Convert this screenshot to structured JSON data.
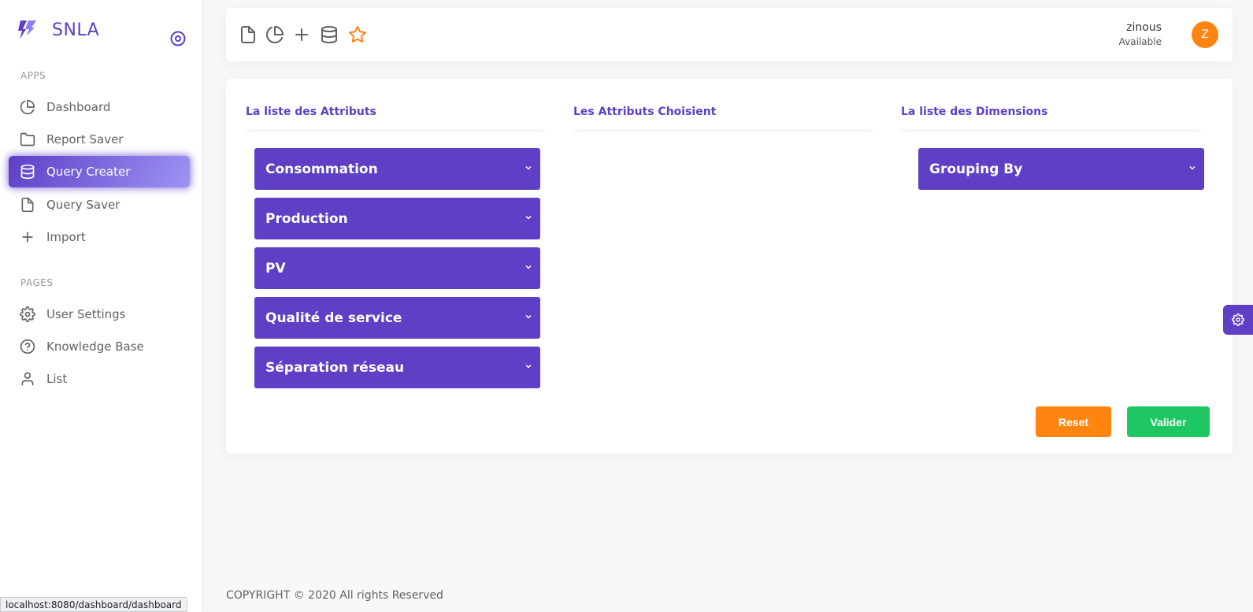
{
  "brand": {
    "name": "SNLA",
    "color": "#5e3fc6"
  },
  "sidebar": {
    "sections": [
      "APPS",
      "PAGES"
    ],
    "apps": [
      {
        "label": "Dashboard",
        "icon": "pie-chart-icon"
      },
      {
        "label": "Report Saver",
        "icon": "folder-icon"
      },
      {
        "label": "Query Creater",
        "icon": "database-icon",
        "active": true
      },
      {
        "label": "Query Saver",
        "icon": "file-icon"
      },
      {
        "label": "Import",
        "icon": "plus-icon"
      }
    ],
    "pages": [
      {
        "label": "User Settings",
        "icon": "gear-icon"
      },
      {
        "label": "Knowledge Base",
        "icon": "help-circle-icon"
      },
      {
        "label": "List",
        "icon": "user-icon"
      }
    ]
  },
  "topbar": {
    "icons": [
      "file-icon",
      "pie-chart-icon",
      "plus-icon",
      "database-icon",
      "star-icon"
    ],
    "user": {
      "name": "zinous",
      "status": "Available",
      "initial": "Z"
    }
  },
  "main": {
    "columns": [
      {
        "title": "La liste des Attributs"
      },
      {
        "title": "Les Attributs Choisient"
      },
      {
        "title": "La liste des Dimensions"
      }
    ],
    "attributes": [
      "Consommation",
      "Production",
      "PV",
      "Qualité de service",
      "Séparation réseau"
    ],
    "dimensions": [
      "Grouping By"
    ],
    "buttons": {
      "reset": "Reset",
      "valider": "Valider"
    }
  },
  "footer": {
    "copyright": "COPYRIGHT © 2020 All rights Reserved"
  },
  "statusbar": {
    "url": "localhost:8080/dashboard/dashboard"
  },
  "colors": {
    "accent": "#5e3fc6",
    "reset": "#ff8510",
    "valider": "#1ec763",
    "avatar": "#ff8510"
  }
}
